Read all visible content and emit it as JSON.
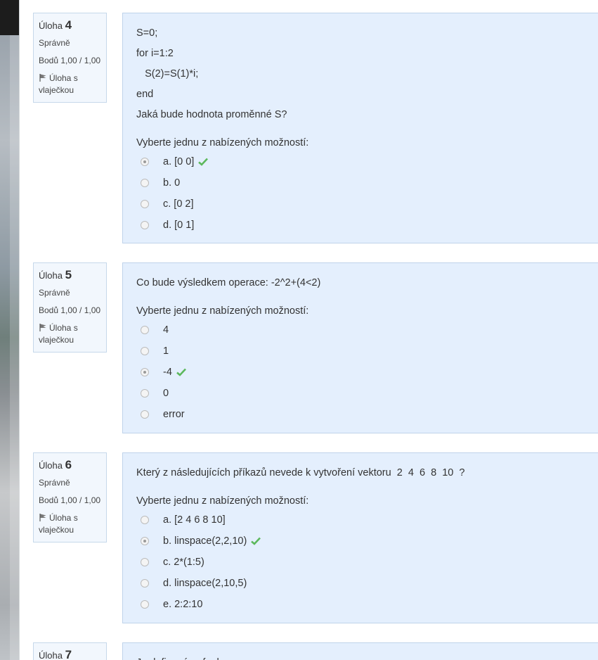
{
  "questions": [
    {
      "label": "Úloha",
      "number": "4",
      "status": "Správně",
      "points": "Bodů 1,00 / 1,00",
      "flag_label": "Úloha s vlaječkou",
      "code": [
        "S=0;",
        "for i=1:2",
        "   S(2)=S(1)*i;",
        "end"
      ],
      "text": "Jaká bude hodnota proměnné S?",
      "prompt": "Vyberte jednu z nabízených možností:",
      "options": [
        "a. [0 0]",
        "b. 0",
        "c. [0 2]",
        "d. [0 1]"
      ],
      "selected": 0
    },
    {
      "label": "Úloha",
      "number": "5",
      "status": "Správně",
      "points": "Bodů 1,00 / 1,00",
      "flag_label": "Úloha s vlaječkou",
      "code": [],
      "text": "Co bude výsledkem operace: -2^2+(4<2)",
      "prompt": "Vyberte jednu z nabízených možností:",
      "options": [
        "4",
        "1",
        "-4",
        "0",
        "error"
      ],
      "selected": 2
    },
    {
      "label": "Úloha",
      "number": "6",
      "status": "Správně",
      "points": "Bodů 1,00 / 1,00",
      "flag_label": "Úloha s vlaječkou",
      "code": [],
      "text": "Který z následujících příkazů nevede k vytvoření vektoru  2  4  6  8  10  ?",
      "prompt": "Vyberte jednu z nabízených možností:",
      "options": [
        "a. [2 4 6 8 10]",
        "b. linspace(2,2,10)",
        "c. 2*(1:5)",
        "d. linspace(2,10,5)",
        "e. 2:2:10"
      ],
      "selected": 1
    },
    {
      "label": "Úloha",
      "number": "7",
      "text": "Je definována funkce"
    }
  ],
  "colors": {
    "correct": "#5cb85c",
    "panel": "#e4effd",
    "info": "#f2f7fd"
  },
  "icons": {
    "flag": "flag-icon",
    "correct": "check-icon"
  }
}
